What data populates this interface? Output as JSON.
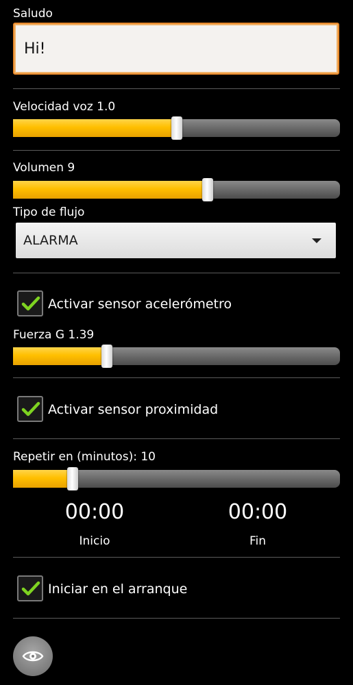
{
  "greeting": {
    "label": "Saludo",
    "value": "Hi!"
  },
  "voice_speed": {
    "label": "Velocidad voz 1.0",
    "fraction": 0.5
  },
  "volume": {
    "label": "Volumen 9",
    "fraction": 0.596
  },
  "stream_type": {
    "label": "Tipo de flujo",
    "selected": "ALARMA"
  },
  "accelerometer": {
    "label": "Activar sensor acelerómetro",
    "checked": true
  },
  "g_force": {
    "label": "Fuerza G 1.39",
    "fraction": 0.287
  },
  "proximity": {
    "label": "Activar sensor proximidad",
    "checked": true
  },
  "repeat": {
    "label": "Repetir en (minutos): 10",
    "fraction": 0.182
  },
  "times": {
    "start_time": "00:00",
    "start_label": "Inicio",
    "end_time": "00:00",
    "end_label": "Fin"
  },
  "boot": {
    "label": "Iniciar en el arranque",
    "checked": true
  },
  "fab": {
    "icon": "eye-icon"
  },
  "colors": {
    "accent": "#ffbf00",
    "focus_border": "#e8892b",
    "check": "#7ed321"
  }
}
